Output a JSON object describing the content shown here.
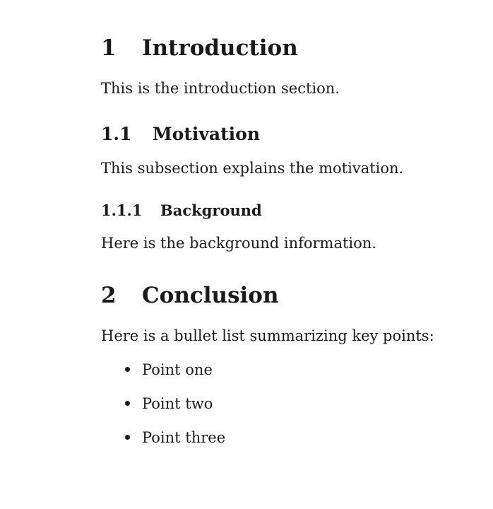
{
  "sections": [
    {
      "number": "1",
      "title": "Introduction",
      "body": "This is the introduction section."
    },
    {
      "number": "2",
      "title": "Conclusion",
      "body": "Here is a bullet list summarizing key points:",
      "bullets": [
        "Point one",
        "Point two",
        "Point three"
      ]
    }
  ],
  "subsection": {
    "number": "1.1",
    "title": "Motivation",
    "body": "This subsection explains the motivation."
  },
  "subsubsection": {
    "number": "1.1.1",
    "title": "Background",
    "body": "Here is the background information."
  }
}
